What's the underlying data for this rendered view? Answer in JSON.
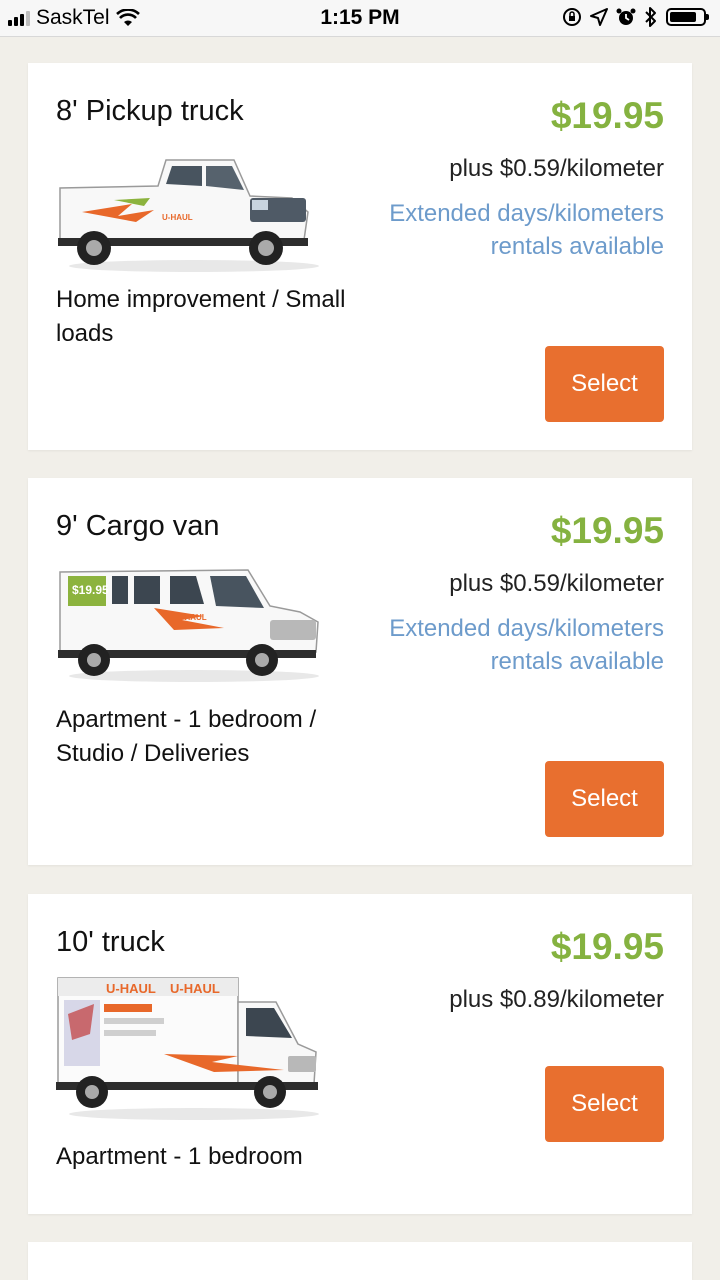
{
  "status_bar": {
    "carrier": "SaskTel",
    "time": "1:15 PM",
    "icons": [
      "signal-icon",
      "wifi-icon",
      "rotation-lock-icon",
      "location-icon",
      "alarm-icon",
      "bluetooth-icon",
      "battery-icon"
    ],
    "battery_level": 0.72
  },
  "colors": {
    "price_green": "#85b240",
    "link_blue": "#6d9bcb",
    "button_orange": "#e86f2f",
    "page_bg": "#f1efe9"
  },
  "vehicles": [
    {
      "title": "8' Pickup truck",
      "image_icon": "pickup-truck-image",
      "description": "Home improvement / Small loads",
      "price": "$19.95",
      "rate": "plus $0.59/kilometer",
      "extended": "Extended days/kilometers rentals available",
      "select_label": "Select"
    },
    {
      "title": "9' Cargo van",
      "image_icon": "cargo-van-image",
      "description": "Apartment - 1 bedroom / Studio / Deliveries",
      "price": "$19.95",
      "rate": "plus $0.59/kilometer",
      "extended": "Extended days/kilometers rentals available",
      "select_label": "Select"
    },
    {
      "title": "10' truck",
      "image_icon": "box-truck-image",
      "description": "Apartment - 1 bedroom",
      "price": "$19.95",
      "rate": "plus $0.89/kilometer",
      "select_label": "Select"
    }
  ]
}
